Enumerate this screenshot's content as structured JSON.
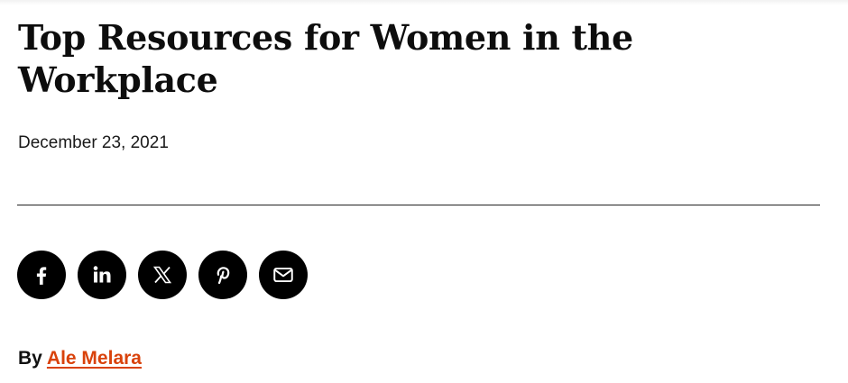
{
  "article": {
    "title": "Top Resources for Women in the Workplace",
    "date": "December 23, 2021"
  },
  "share": {
    "buttons": [
      {
        "name": "facebook",
        "icon": "facebook-icon"
      },
      {
        "name": "linkedin",
        "icon": "linkedin-icon"
      },
      {
        "name": "x",
        "icon": "x-icon"
      },
      {
        "name": "pinterest",
        "icon": "pinterest-icon"
      },
      {
        "name": "email",
        "icon": "envelope-icon"
      }
    ]
  },
  "byline": {
    "prefix": "By",
    "author": "Ale Melara"
  },
  "colors": {
    "author_link": "#d9420b",
    "share_button_bg": "#000000",
    "share_icon": "#ffffff"
  }
}
